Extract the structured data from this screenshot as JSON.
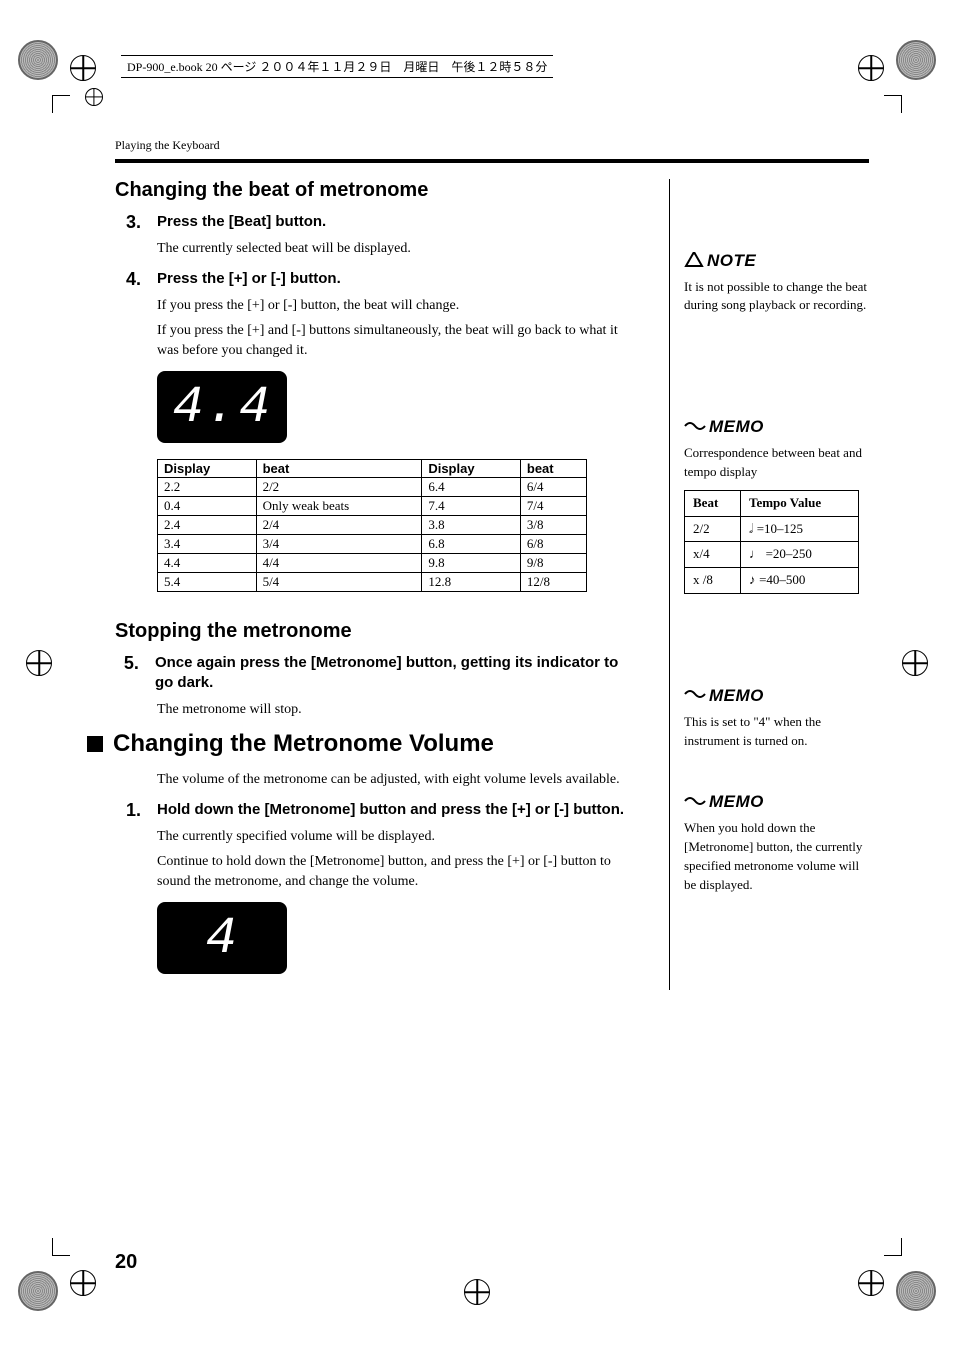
{
  "header_line": "DP-900_e.book  20 ページ  ２００４年１１月２９日　月曜日　午後１２時５８分",
  "breadcrumb": "Playing the Keyboard",
  "page_number": "20",
  "sections": {
    "changing_beat": {
      "title": "Changing the beat of metronome",
      "step3": {
        "num": "3.",
        "title": "Press the [Beat] button.",
        "body": "The currently selected beat will be displayed."
      },
      "step4": {
        "num": "4.",
        "title": "Press the [+] or [-] button.",
        "body1": "If you press the [+] or [-] button, the beat will change.",
        "body2": "If you press the [+] and [-] buttons simultaneously, the beat will go back to what it was before you changed it."
      },
      "display_value": "4.4"
    },
    "stopping": {
      "title": "Stopping the metronome",
      "step5": {
        "num": "5.",
        "title": "Once again press the [Metronome] button, getting its indicator to go dark.",
        "body": "The metronome will stop."
      }
    },
    "volume": {
      "title": "Changing the Metronome Volume",
      "intro": "The volume of the metronome can be adjusted, with eight volume levels available.",
      "step1": {
        "num": "1.",
        "title": "Hold down the [Metronome] button and press the [+] or [-] button.",
        "body1": "The currently specified volume will be displayed.",
        "body2": "Continue to hold down the [Metronome] button, and press the [+] or [-] button to sound the metronome, and change the volume."
      },
      "display_value": "4"
    }
  },
  "beat_table": {
    "headers": [
      "Display",
      "beat",
      "Display",
      "beat"
    ],
    "rows": [
      [
        "2.2",
        "2/2",
        "6.4",
        "6/4"
      ],
      [
        "0.4",
        "Only weak beats",
        "7.4",
        "7/4"
      ],
      [
        "2.4",
        "2/4",
        "3.8",
        "3/8"
      ],
      [
        "3.4",
        "3/4",
        "6.8",
        "6/8"
      ],
      [
        "4.4",
        "4/4",
        "9.8",
        "9/8"
      ],
      [
        "5.4",
        "5/4",
        "12.8",
        "12/8"
      ]
    ]
  },
  "sidebar": {
    "note": {
      "label": "NOTE",
      "text": "It is not possible to change the beat during song playback or recording."
    },
    "memo1": {
      "label": "MEMO",
      "text": "Correspondence between beat and tempo display"
    },
    "tempo_table": {
      "headers": [
        "Beat",
        "Tempo Value"
      ],
      "rows": [
        {
          "beat": "2/2",
          "sym": "𝅗𝅥",
          "val": "=10–125"
        },
        {
          "beat": "x/4",
          "sym": "♩",
          "val": "=20–250"
        },
        {
          "beat": "x /8",
          "sym": "♪",
          "val": "=40–500"
        }
      ]
    },
    "memo2": {
      "label": "MEMO",
      "text": "This is set to \"4\" when the instrument is turned on."
    },
    "memo3": {
      "label": "MEMO",
      "text": "When you hold down the [Metronome] button, the currently specified metronome volume will be displayed."
    }
  }
}
